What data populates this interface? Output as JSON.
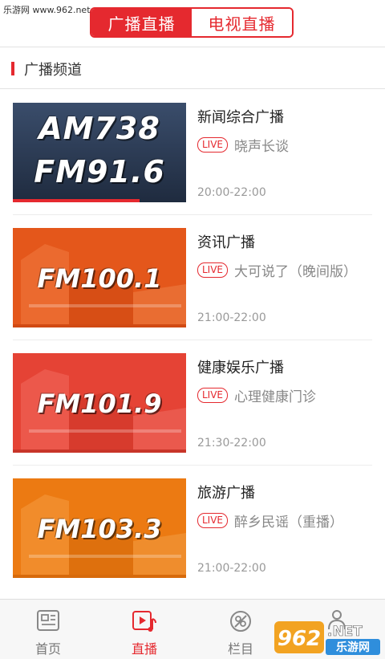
{
  "watermark_top": "乐游网 www.962.net",
  "header": {
    "tabs": [
      {
        "label": "广播直播",
        "active": true
      },
      {
        "label": "电视直播",
        "active": false
      }
    ]
  },
  "section": {
    "title": "广播频道"
  },
  "channels": [
    {
      "name": "新闻综合广播",
      "live": "LIVE",
      "program": "晓声长谈",
      "time": "20:00-22:00",
      "thumb_text_1": "AM738",
      "thumb_text_2": "FM91.6",
      "thumb_color": "#2a3a52"
    },
    {
      "name": "资讯广播",
      "live": "LIVE",
      "program": "大可说了（晚间版）",
      "time": "21:00-22:00",
      "thumb_text_1": "FM100.1",
      "thumb_color": "#e4571b"
    },
    {
      "name": "健康娱乐广播",
      "live": "LIVE",
      "program": "心理健康门诊",
      "time": "21:30-22:00",
      "thumb_text_1": "FM101.9",
      "thumb_color": "#e54335"
    },
    {
      "name": "旅游广播",
      "live": "LIVE",
      "program": "醉乡民谣（重播）",
      "time": "21:00-22:00",
      "thumb_text_1": "FM103.3",
      "thumb_color": "#ec7a12"
    }
  ],
  "tabbar": {
    "items": [
      {
        "label": "首页",
        "icon": "news-icon",
        "active": false
      },
      {
        "label": "直播",
        "icon": "live-music-icon",
        "active": true
      },
      {
        "label": "栏目",
        "icon": "columns-icon",
        "active": false
      },
      {
        "label": "",
        "icon": "user-icon",
        "active": false
      }
    ]
  },
  "watermark_logo": {
    "text_1": "962",
    "text_2": ".NET",
    "text_3": "乐游网"
  },
  "colors": {
    "accent": "#e5292f"
  }
}
